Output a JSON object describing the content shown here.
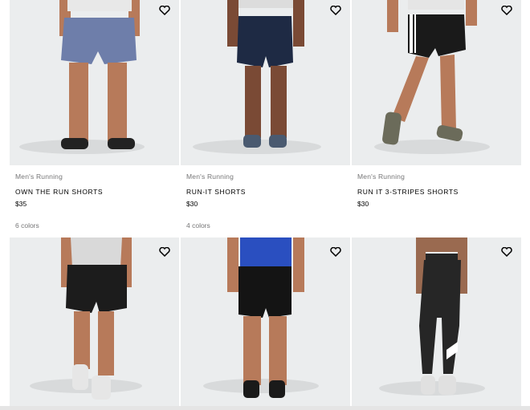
{
  "products": [
    {
      "category": "Men's Running",
      "name": "OWN THE RUN SHORTS",
      "price": "$35",
      "colors": "6 colors",
      "shorts_color": "#6e7eaa",
      "shirt_color": "#e8e8e8",
      "shoe_color": "#222222"
    },
    {
      "category": "Men's Running",
      "name": "RUN-IT SHORTS",
      "price": "$30",
      "colors": "4 colors",
      "shorts_color": "#1e2a44",
      "shirt_color": "#dcdcdc",
      "shoe_color": "#4a5a70"
    },
    {
      "category": "Men's Running",
      "name": "RUN IT 3-STRIPES SHORTS",
      "price": "$30",
      "colors": "",
      "shorts_color": "#1a1a1a",
      "shirt_color": "#e5e5e5",
      "shoe_color": "#6b6b5a"
    },
    {
      "category": "",
      "name": "",
      "price": "",
      "colors": "",
      "shorts_color": "#1c1c1c",
      "shirt_color": "#d9d9d9",
      "shoe_color": "#e6e6e6"
    },
    {
      "category": "",
      "name": "",
      "price": "",
      "colors": "",
      "shorts_color": "#141414",
      "shirt_color": "#2a4fc0",
      "shoe_color": "#1a1a1a"
    },
    {
      "category": "",
      "name": "",
      "price": "",
      "colors": "",
      "shorts_color": "#262626",
      "shirt_color": "#262626",
      "shoe_color": "#e0e0e0"
    }
  ],
  "icons": {
    "wishlist": "heart-icon"
  },
  "colors": {
    "image_bg": "#ebedee",
    "muted_text": "#767677",
    "skin": "#b77a5a"
  }
}
